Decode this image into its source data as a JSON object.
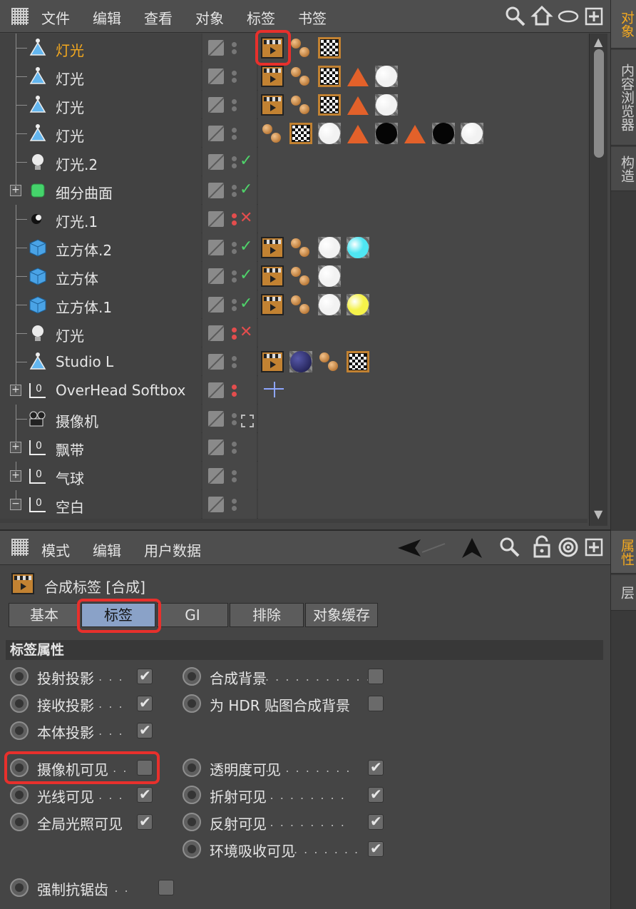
{
  "colors": {
    "accent": "#f4a91f",
    "highlight": "#e8302c",
    "selected_tab": "#8aa2c8",
    "check": "#4fd36a"
  },
  "object_manager": {
    "menu": [
      "文件",
      "编辑",
      "查看",
      "对象",
      "标签",
      "书签"
    ],
    "toolbar_icons": [
      "search-icon",
      "home-icon",
      "eye-icon",
      "add-panel-icon"
    ],
    "rows": [
      {
        "name": "灯光",
        "icon": "light-cone-icon",
        "active": true,
        "expander": "",
        "vis_dots": [
          "gray",
          "gray"
        ],
        "status": "",
        "tags": [
          "clapper",
          "phong",
          "checker"
        ]
      },
      {
        "name": "灯光",
        "icon": "light-cone-icon",
        "active": false,
        "expander": "",
        "vis_dots": [
          "gray",
          "gray"
        ],
        "status": "",
        "tags": [
          "clapper",
          "phong",
          "checker",
          "triangle",
          "mat-white"
        ]
      },
      {
        "name": "灯光",
        "icon": "light-cone-icon",
        "active": false,
        "expander": "",
        "vis_dots": [
          "gray",
          "gray"
        ],
        "status": "",
        "tags": [
          "clapper",
          "phong",
          "checker",
          "triangle",
          "mat-white"
        ]
      },
      {
        "name": "灯光",
        "icon": "light-cone-icon",
        "active": false,
        "expander": "",
        "vis_dots": [
          "gray",
          "gray"
        ],
        "status": "",
        "tags": [
          "phong",
          "checker",
          "mat-white",
          "triangle",
          "mat-black",
          "triangle",
          "mat-black",
          "mat-white"
        ]
      },
      {
        "name": "灯光.2",
        "icon": "bulb-icon",
        "active": false,
        "expander": "",
        "vis_dots": [
          "gray",
          "gray"
        ],
        "status": "check",
        "tags": []
      },
      {
        "name": "细分曲面",
        "icon": "subdivision-icon",
        "active": false,
        "expander": "+",
        "vis_dots": [
          "gray",
          "gray"
        ],
        "status": "check",
        "tags": []
      },
      {
        "name": "灯光.1",
        "icon": "spot-light-icon",
        "active": false,
        "expander": "",
        "vis_dots": [
          "red",
          "red"
        ],
        "status": "cross",
        "tags": []
      },
      {
        "name": "立方体.2",
        "icon": "cube-icon",
        "active": false,
        "expander": "",
        "vis_dots": [
          "gray",
          "gray"
        ],
        "status": "check",
        "tags": [
          "clapper",
          "phong",
          "mat-white",
          "mat-cyan"
        ]
      },
      {
        "name": "立方体",
        "icon": "cube-icon",
        "active": false,
        "expander": "",
        "vis_dots": [
          "gray",
          "gray"
        ],
        "status": "check",
        "tags": [
          "clapper",
          "phong",
          "mat-white"
        ]
      },
      {
        "name": "立方体.1",
        "icon": "cube-icon",
        "active": false,
        "expander": "",
        "vis_dots": [
          "gray",
          "gray"
        ],
        "status": "check",
        "tags": [
          "clapper",
          "phong",
          "mat-white",
          "mat-yellow"
        ]
      },
      {
        "name": "灯光",
        "icon": "bulb-icon",
        "active": false,
        "expander": "",
        "vis_dots": [
          "red",
          "red"
        ],
        "status": "cross",
        "tags": []
      },
      {
        "name": "Studio L",
        "icon": "light-cone-icon",
        "active": false,
        "expander": "",
        "vis_dots": [
          "gray",
          "gray"
        ],
        "status": "",
        "tags": [
          "clapper",
          "mat-navy",
          "phong",
          "checker"
        ]
      },
      {
        "name": "OverHead Softbox",
        "icon": "null-icon",
        "active": false,
        "expander": "+",
        "vis_dots": [
          "red",
          "red"
        ],
        "status": "",
        "tags": [
          "xpresso"
        ]
      },
      {
        "name": "摄像机",
        "icon": "camera-icon",
        "active": false,
        "expander": "",
        "vis_dots": [
          "gray",
          "gray"
        ],
        "status": "target",
        "tags": []
      },
      {
        "name": "飘带",
        "icon": "null-icon",
        "active": false,
        "expander": "+",
        "vis_dots": [
          "gray",
          "gray"
        ],
        "status": "",
        "tags": []
      },
      {
        "name": "气球",
        "icon": "null-icon",
        "active": false,
        "expander": "+",
        "vis_dots": [
          "gray",
          "gray"
        ],
        "status": "",
        "tags": []
      },
      {
        "name": "空白",
        "icon": "null-icon",
        "active": false,
        "expander": "-",
        "vis_dots": [
          "gray",
          "gray"
        ],
        "status": "",
        "tags": []
      }
    ]
  },
  "right_tabs_top": [
    "对象",
    "内容浏览器",
    "构造"
  ],
  "right_tabs_bottom": [
    "属性",
    "层"
  ],
  "attribute_manager": {
    "menu": [
      "模式",
      "编辑",
      "用户数据"
    ],
    "toolbar_icons": [
      "back-arrow-icon",
      "up-arrow-icon",
      "search-icon",
      "lock-icon",
      "target-icon",
      "add-panel-icon"
    ],
    "title": "合成标签 [合成]",
    "tabs": [
      {
        "label": "基本",
        "selected": false
      },
      {
        "label": "标签",
        "selected": true
      },
      {
        "label": "GI",
        "selected": false
      },
      {
        "label": "排除",
        "selected": false
      },
      {
        "label": "对象缓存",
        "selected": false
      }
    ],
    "section": "标签属性",
    "left_props": [
      {
        "label": "投射投影",
        "dots": ". . . .",
        "checked": true
      },
      {
        "label": "接收投影",
        "dots": ". . . .",
        "checked": true
      },
      {
        "label": "本体投影",
        "dots": ". . . .",
        "checked": true
      },
      {
        "label": "摄像机可见",
        "dots": ". . .",
        "checked": false
      },
      {
        "label": "光线可见",
        "dots": ". . . .",
        "checked": true
      },
      {
        "label": "全局光照可见",
        "dots": "",
        "checked": true
      }
    ],
    "right_props": [
      {
        "label": "合成背景",
        "dots": ". . . . . . . . . . .",
        "checked": false
      },
      {
        "label": "为 HDR 贴图合成背景",
        "dots": "",
        "checked": false
      },
      {
        "label": "透明度可见",
        "dots": ". . . . . . . . .",
        "checked": true
      },
      {
        "label": "折射可见",
        "dots": ". . . . . . . . . . .",
        "checked": true
      },
      {
        "label": "反射可见",
        "dots": ". . . . . . . . . . .",
        "checked": true
      },
      {
        "label": "环境吸收可见",
        "dots": ". . . . . . .",
        "checked": true
      }
    ],
    "bottom_prop": {
      "label": "强制抗锯齿",
      "dots": ". . . .",
      "checked": false
    }
  }
}
